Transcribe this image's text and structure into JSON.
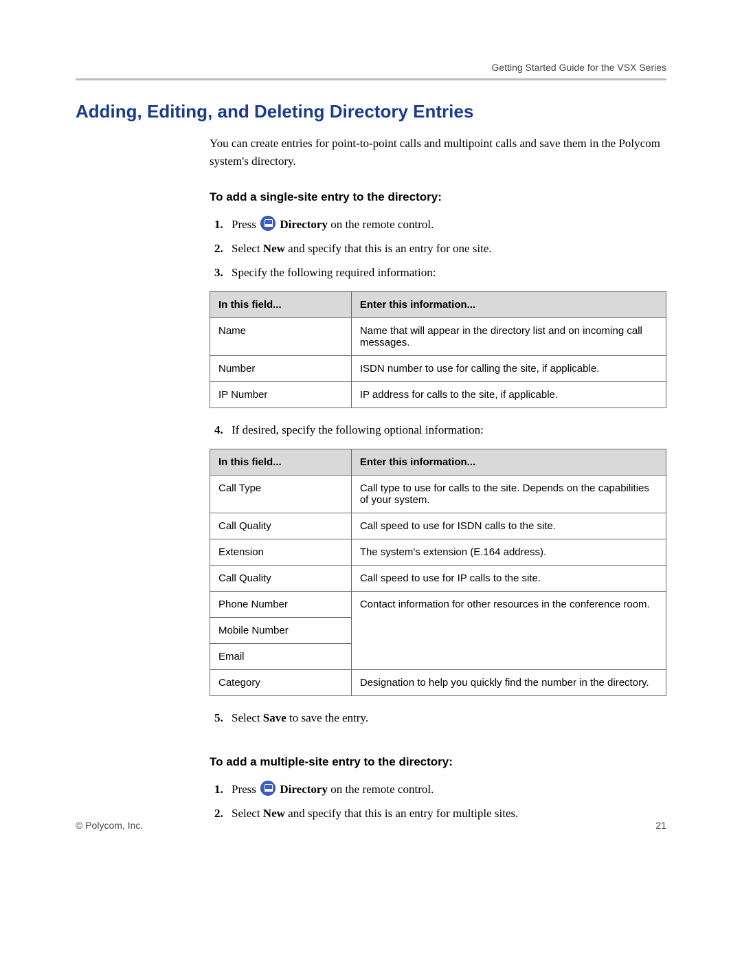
{
  "header": {
    "running_head": "Getting Started Guide for the VSX Series"
  },
  "section": {
    "title": "Adding, Editing, and Deleting Directory Entries",
    "intro": "You can create entries for point-to-point calls and multipoint calls and save them in the Polycom system's directory."
  },
  "single_site": {
    "heading": "To add a single-site entry to the directory:",
    "step1_pre": "Press ",
    "step1_bold": " Directory",
    "step1_post": " on the remote control.",
    "step2_pre": "Select ",
    "step2_bold": "New",
    "step2_post": " and specify that this is an entry for one site.",
    "step3": "Specify the following required information:",
    "step4": "If desired, specify the following optional information:",
    "step5_pre": "Select ",
    "step5_bold": "Save",
    "step5_post": " to save the entry."
  },
  "table_required": {
    "head_field": "In this field...",
    "head_info": "Enter this information...",
    "rows": [
      {
        "field": "Name",
        "info": "Name that will appear in the directory list and on incoming call messages."
      },
      {
        "field": "Number",
        "info": "ISDN number to use for calling the site, if applicable."
      },
      {
        "field": "IP Number",
        "info": "IP address for calls to the site, if applicable."
      }
    ]
  },
  "table_optional": {
    "head_field": "In this field...",
    "head_info": "Enter this information...",
    "rows": [
      {
        "field": "Call Type",
        "info": "Call type to use for calls to the site. Depends on the capabilities of your system."
      },
      {
        "field": "Call Quality",
        "info": "Call speed to use for ISDN calls to the site."
      },
      {
        "field": "Extension",
        "info": "The system's extension (E.164 address)."
      },
      {
        "field": "Call Quality",
        "info": "Call speed to use for IP calls to the site."
      }
    ],
    "group_fields": [
      "Phone Number",
      "Mobile Number",
      "Email"
    ],
    "group_info": "Contact information for other resources in the conference room.",
    "last_row": {
      "field": "Category",
      "info": "Designation to help you quickly find the number in the directory."
    }
  },
  "multi_site": {
    "heading": "To add a multiple-site entry to the directory:",
    "step1_pre": "Press ",
    "step1_bold": " Directory",
    "step1_post": " on the remote control.",
    "step2_pre": "Select ",
    "step2_bold": "New",
    "step2_post": " and specify that this is an entry for multiple sites."
  },
  "footer": {
    "left": "© Polycom, Inc.",
    "right": "21"
  }
}
